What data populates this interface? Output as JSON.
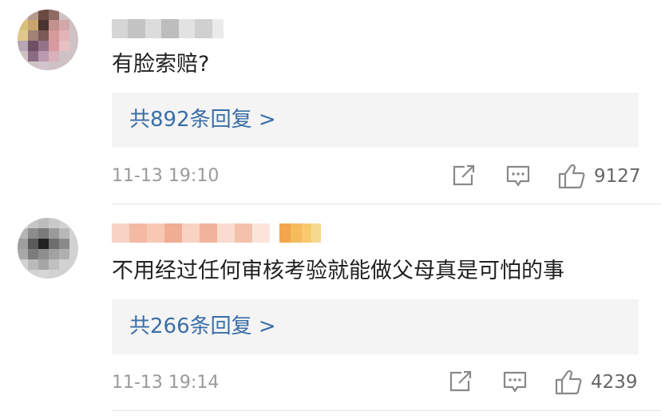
{
  "comments": [
    {
      "text": "有脸索赔?",
      "replies_label": "共892条回复 >",
      "timestamp": "11-13 19:10",
      "likes": "9127",
      "icons": {
        "share": "share-icon",
        "comment": "comment-icon",
        "like": "thumbs-up-icon"
      }
    },
    {
      "text": "不用经过任何审核考验就能做父母真是可怕的事",
      "replies_label": "共266条回复 >",
      "timestamp": "11-13 19:14",
      "likes": "4239",
      "icons": {
        "share": "share-icon",
        "comment": "comment-icon",
        "like": "thumbs-up-icon"
      }
    }
  ],
  "colors": {
    "link": "#3a6ea8",
    "reply_box_bg": "#f4f4f4",
    "meta": "#9a9a9a",
    "text": "#222222"
  }
}
